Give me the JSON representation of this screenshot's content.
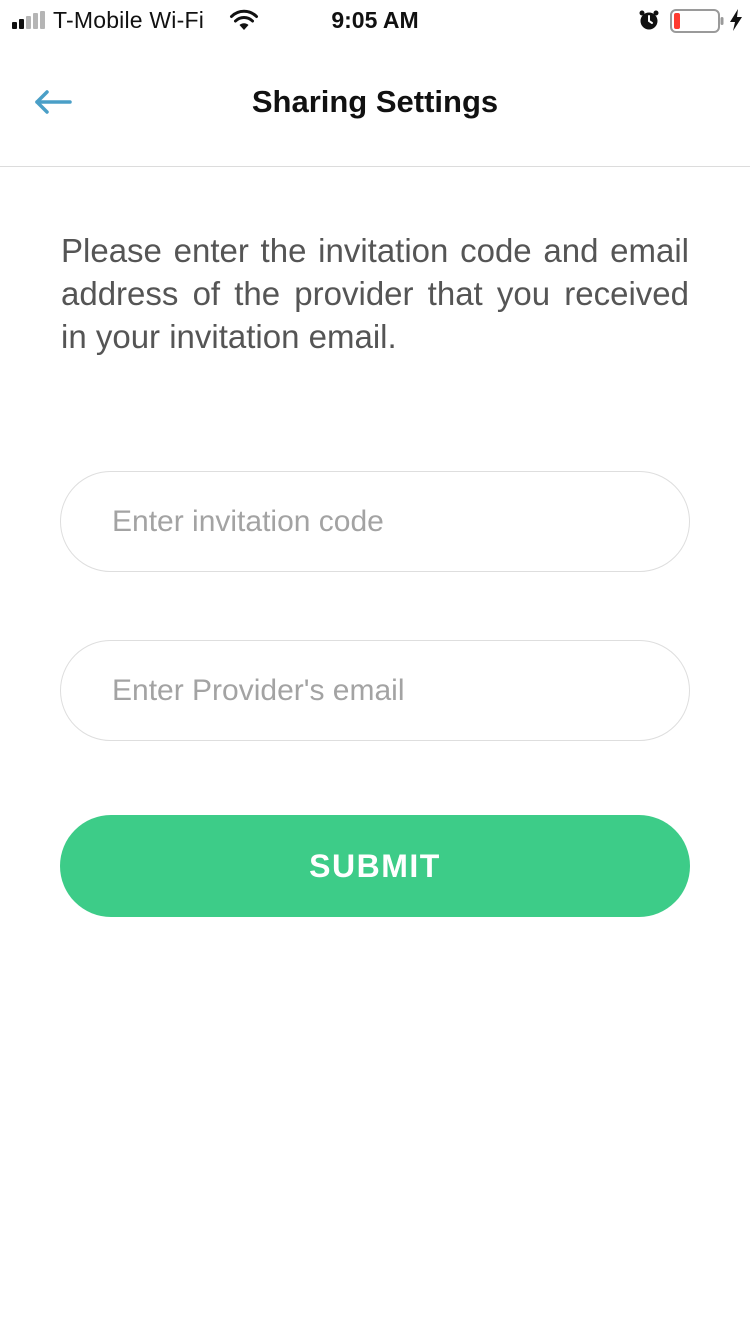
{
  "status_bar": {
    "carrier": "T-Mobile Wi-Fi",
    "time": "9:05 AM",
    "icons": [
      "signal-icon",
      "wifi-icon",
      "alarm-icon",
      "battery-icon",
      "charging-icon"
    ],
    "battery_color": "#ff3b30"
  },
  "header": {
    "title": "Sharing Settings",
    "back_icon": "arrow-left-icon",
    "back_color": "#4a9fc7"
  },
  "main": {
    "instructions": "Please enter the invitation code and email address of the provider that you received in your invitation email.",
    "code_input": {
      "placeholder": "Enter invitation code",
      "value": ""
    },
    "email_input": {
      "placeholder": "Enter Provider's email",
      "value": ""
    },
    "submit_label": "SUBMIT",
    "accent_color": "#3dcc88"
  }
}
